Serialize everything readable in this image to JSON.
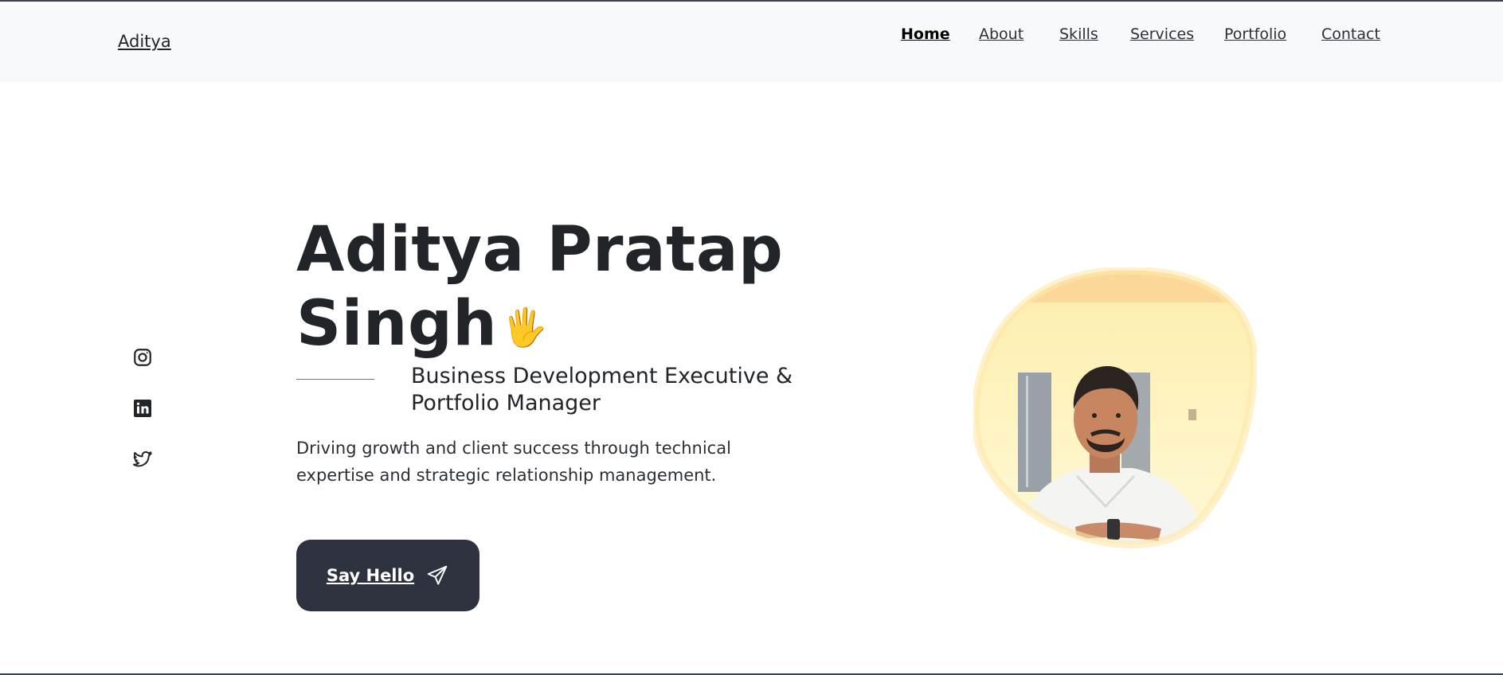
{
  "header": {
    "brand": "Aditya",
    "nav": [
      {
        "label": "Home",
        "active": true
      },
      {
        "label": "About",
        "active": false
      },
      {
        "label": "Skills",
        "active": false
      },
      {
        "label": "Services",
        "active": false
      },
      {
        "label": "Portfolio",
        "active": false
      },
      {
        "label": "Contact",
        "active": false
      }
    ]
  },
  "socials": [
    {
      "icon": "instagram-icon"
    },
    {
      "icon": "linkedin-icon"
    },
    {
      "icon": "twitter-icon"
    }
  ],
  "hero": {
    "name_line1": "Aditya Pratap",
    "name_line2": "Singh",
    "wave": "🖐",
    "subtitle": "Business Development Executive & Portfolio Manager",
    "description": "Driving growth and client success through technical expertise and strategic relationship management.",
    "cta_label": "Say Hello",
    "cta_icon": "send-icon"
  },
  "colors": {
    "header_bg": "#f8f9fa",
    "button_bg": "#2e323e",
    "blob": "#fde9a6",
    "text": "#212529"
  }
}
